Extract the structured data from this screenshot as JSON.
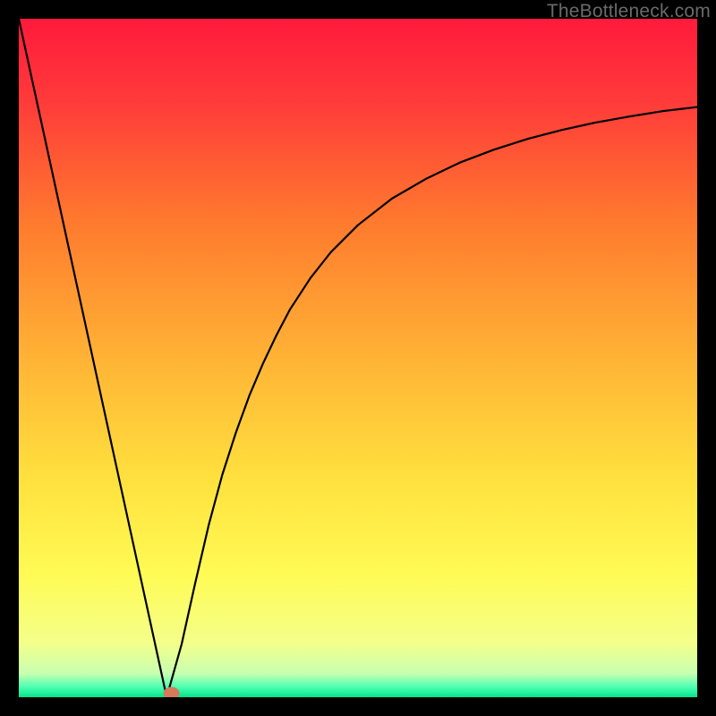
{
  "watermark": "TheBottleneck.com",
  "chart_data": {
    "type": "line",
    "title": "",
    "xlabel": "",
    "ylabel": "",
    "xlim": [
      0,
      1
    ],
    "ylim": [
      0,
      1
    ],
    "background_gradient": {
      "stops": [
        {
          "pos": 0.0,
          "color": "#ff1a3c"
        },
        {
          "pos": 0.12,
          "color": "#ff3a3a"
        },
        {
          "pos": 0.3,
          "color": "#ff7a2e"
        },
        {
          "pos": 0.5,
          "color": "#ffb335"
        },
        {
          "pos": 0.68,
          "color": "#ffe13e"
        },
        {
          "pos": 0.82,
          "color": "#fffb55"
        },
        {
          "pos": 0.92,
          "color": "#f4ff8a"
        },
        {
          "pos": 0.965,
          "color": "#c8ffb0"
        },
        {
          "pos": 0.985,
          "color": "#4dffb3"
        },
        {
          "pos": 1.0,
          "color": "#00e58a"
        }
      ]
    },
    "series": [
      {
        "name": "left-branch",
        "x": [
          0.0,
          0.218
        ],
        "y": [
          1.0,
          0.0
        ]
      },
      {
        "name": "right-curve",
        "x": [
          0.218,
          0.24,
          0.26,
          0.28,
          0.3,
          0.32,
          0.34,
          0.36,
          0.38,
          0.4,
          0.43,
          0.46,
          0.5,
          0.55,
          0.6,
          0.65,
          0.7,
          0.75,
          0.8,
          0.85,
          0.9,
          0.95,
          1.0
        ],
        "y": [
          0.0,
          0.078,
          0.168,
          0.254,
          0.328,
          0.39,
          0.445,
          0.492,
          0.534,
          0.572,
          0.618,
          0.656,
          0.696,
          0.735,
          0.764,
          0.788,
          0.807,
          0.823,
          0.836,
          0.847,
          0.856,
          0.864,
          0.87
        ]
      }
    ],
    "marker": {
      "x": 0.225,
      "y": 0.006,
      "color": "#d57a5c",
      "rx": 9,
      "ry": 7
    }
  }
}
